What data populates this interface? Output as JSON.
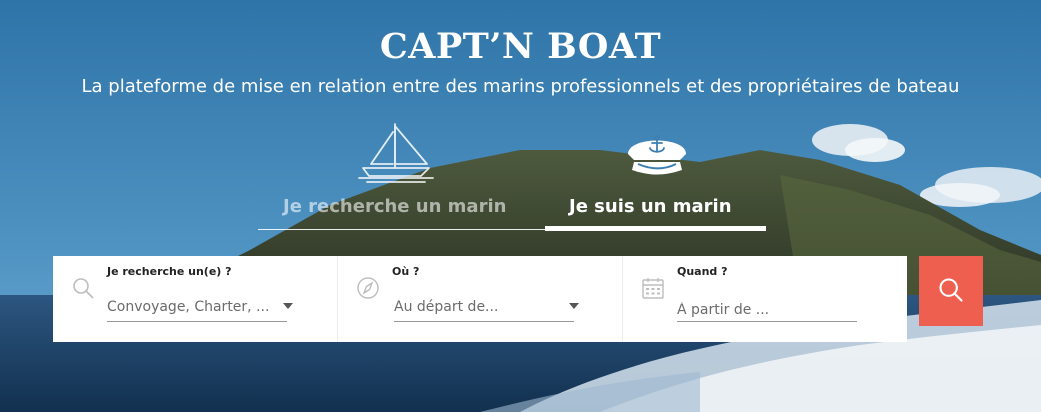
{
  "header": {
    "brand": "CAPT’N BOAT",
    "tagline": "La plateforme de mise en relation entre des marins professionnels et des propriétaires de bateau"
  },
  "tabs": [
    {
      "label": "Je recherche un marin",
      "icon": "sailboat-icon",
      "active": false
    },
    {
      "label": "Je suis un marin",
      "icon": "captain-hat-icon",
      "active": true
    }
  ],
  "search_form": {
    "fields": [
      {
        "label": "Je recherche un(e) ?",
        "value": "Convoyage, Charter, ...",
        "icon": "search-icon"
      },
      {
        "label": "Où ?",
        "value": "Au départ de...",
        "icon": "compass-icon"
      },
      {
        "label": "Quand ?",
        "placeholder": "À partir de ...",
        "icon": "calendar-icon"
      }
    ],
    "submit_icon": "search-icon"
  },
  "colors": {
    "accent": "#ef5f50",
    "sky": "#3d7fb0",
    "sea": "#1d3f66",
    "text_on_hero": "#ffffff"
  }
}
